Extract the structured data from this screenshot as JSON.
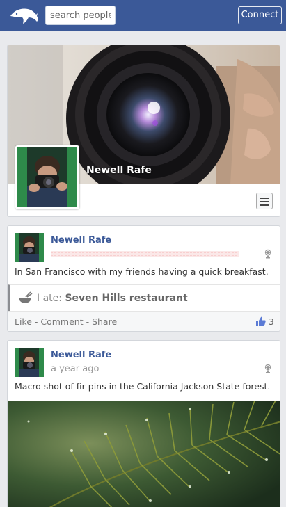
{
  "topbar": {
    "search_placeholder": "search people,",
    "connect_label": "Connect"
  },
  "profile": {
    "name": "Newell Rafe"
  },
  "posts": [
    {
      "author": "Newell Rafe",
      "time": "",
      "text": "In San Francisco with my friends having a quick breakfast.",
      "checkin": {
        "prefix": "I ate: ",
        "place": "Seven Hills restaurant"
      },
      "actions": "Like - Comment - Share",
      "likes": "3"
    },
    {
      "author": "Newell Rafe",
      "time": "a year ago",
      "text": "Macro shot of fir pins in the California Jackson State forest."
    }
  ],
  "colors": {
    "brand": "#3b5998",
    "background": "#e9eaed",
    "like_blue": "#5b7bd5"
  },
  "icons": [
    "dolphin-logo-icon",
    "hamburger-menu-icon",
    "globe-privacy-icon",
    "meal-bowl-icon",
    "thumbs-up-icon"
  ]
}
